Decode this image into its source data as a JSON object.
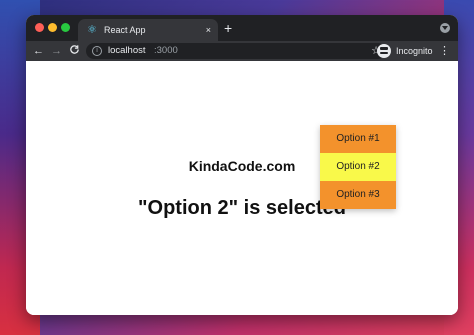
{
  "browser": {
    "tab_title": "React App",
    "tab_close": "×",
    "new_tab": "+",
    "url_host": "localhost",
    "url_port": ":3000",
    "profile_label": "Incognito",
    "icons": {
      "back": "←",
      "forward": "→",
      "reload": "C",
      "info": "i",
      "star": "☆",
      "menu": "⋮",
      "favicon": "⚛"
    }
  },
  "page": {
    "site_title": "KindaCode.com",
    "selected_text": "\"Option 2\" is selected"
  },
  "menu": {
    "items": [
      {
        "label": "Option #1",
        "color": "#f3922c"
      },
      {
        "label": "Option #2",
        "color": "#f9f94a"
      },
      {
        "label": "Option #3",
        "color": "#f3922c"
      }
    ]
  }
}
